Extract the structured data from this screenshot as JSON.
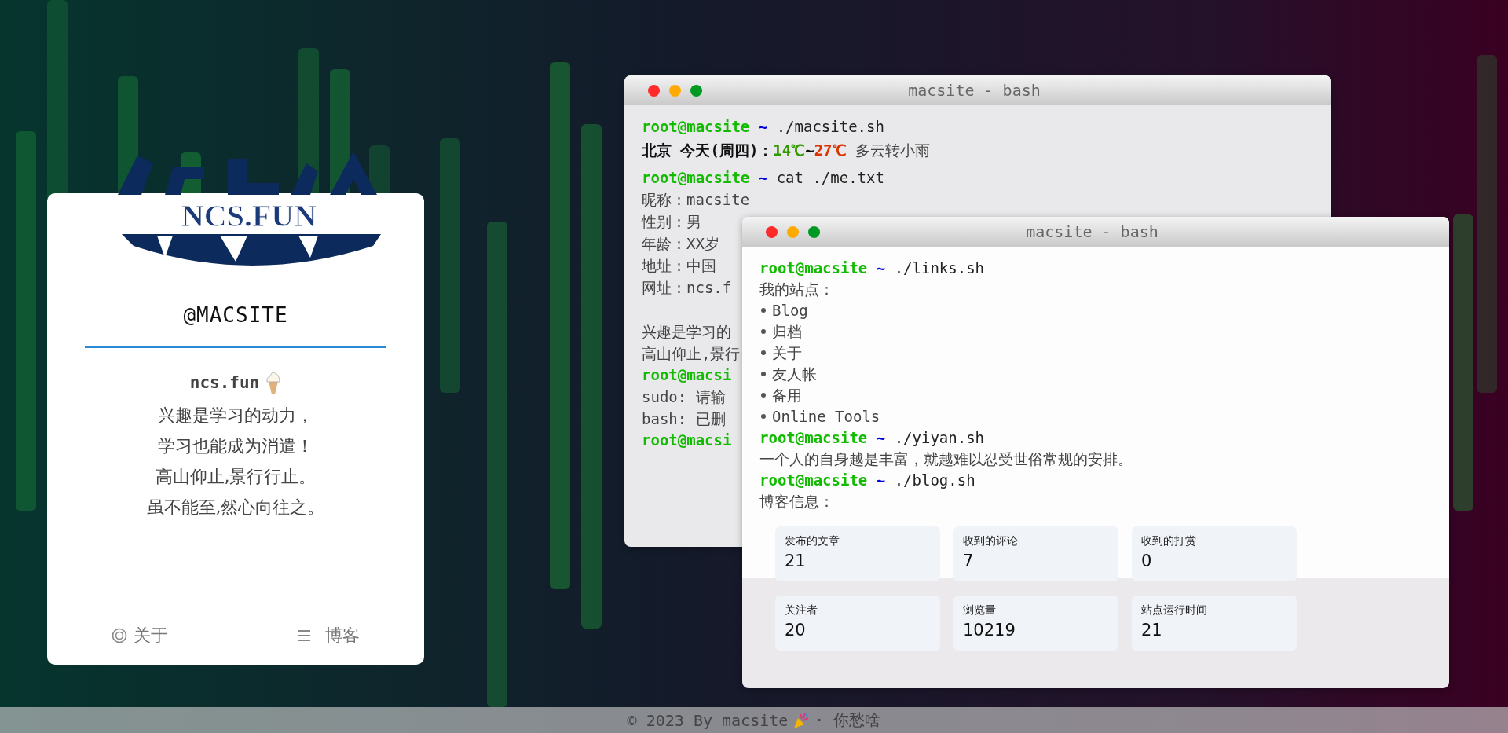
{
  "profile_card": {
    "logo_text": "NCS.FUN",
    "handle": "@MACSITE",
    "site": "ncs.fun",
    "motto": [
      "兴趣是学习的动力，",
      "学习也能成为消遣！",
      "高山仰止,景行行止。",
      "虽不能至,然心向往之。"
    ],
    "links": [
      {
        "kind": "about",
        "label": "关于"
      },
      {
        "kind": "blog",
        "label": "博客"
      }
    ]
  },
  "terminals": [
    {
      "title": "macsite - bash",
      "lines": [
        {
          "kind": "prompt",
          "user": "root@macsite",
          "path": "~",
          "command": "./macsite.sh"
        },
        {
          "kind": "weather",
          "place": "北京 今天(周四)：",
          "low": "14℃",
          "sep": "~",
          "high": "27℃",
          "desc": "多云转小雨"
        },
        {
          "kind": "prompt",
          "user": "root@macsite",
          "path": "~",
          "command": "cat ./me.txt"
        },
        {
          "kind": "text",
          "text": "昵称：macsite"
        },
        {
          "kind": "text",
          "text": "性别：男"
        },
        {
          "kind": "text",
          "text": "年龄：XX岁"
        },
        {
          "kind": "text",
          "text": "地址：中国"
        },
        {
          "kind": "text",
          "text": "网址：ncs.f"
        },
        {
          "kind": "blank"
        },
        {
          "kind": "text",
          "text": "兴趣是学习的"
        },
        {
          "kind": "text",
          "text": "高山仰止,景行"
        },
        {
          "kind": "prompt",
          "user": "root@macsi"
        },
        {
          "kind": "text",
          "text": "sudo: 请输"
        },
        {
          "kind": "text",
          "text": "bash: 已删"
        },
        {
          "kind": "prompt",
          "user": "root@macsi"
        }
      ]
    },
    {
      "title": "macsite - bash",
      "lines": [
        {
          "kind": "prompt",
          "user": "root@macsite",
          "path": "~",
          "command": "./links.sh"
        },
        {
          "kind": "text",
          "text": "我的站点："
        },
        {
          "kind": "bullet",
          "text": "Blog"
        },
        {
          "kind": "bullet",
          "text": "归档"
        },
        {
          "kind": "bullet",
          "text": "关于"
        },
        {
          "kind": "bullet",
          "text": "友人帐"
        },
        {
          "kind": "bullet",
          "text": "备用"
        },
        {
          "kind": "bullet",
          "text": "Online Tools"
        },
        {
          "kind": "prompt",
          "user": "root@macsite",
          "path": "~",
          "command": "./yiyan.sh"
        },
        {
          "kind": "text",
          "text": "一个人的自身越是丰富，就越难以忍受世俗常规的安排。"
        },
        {
          "kind": "prompt",
          "user": "root@macsite",
          "path": "~",
          "command": "./blog.sh"
        },
        {
          "kind": "text",
          "text": "博客信息："
        },
        {
          "kind": "stats",
          "items": [
            {
              "label": "发布的文章",
              "value": "21"
            },
            {
              "label": "收到的评论",
              "value": "7"
            },
            {
              "label": "收到的打赏",
              "value": "0"
            },
            {
              "label": "关注者",
              "value": "20"
            },
            {
              "label": "浏览量",
              "value": "10219"
            },
            {
              "label": "站点运行时间",
              "value": "21"
            }
          ]
        }
      ]
    }
  ],
  "footer": {
    "left": "© 2023 By macsite",
    "right": "· 你愁啥"
  }
}
